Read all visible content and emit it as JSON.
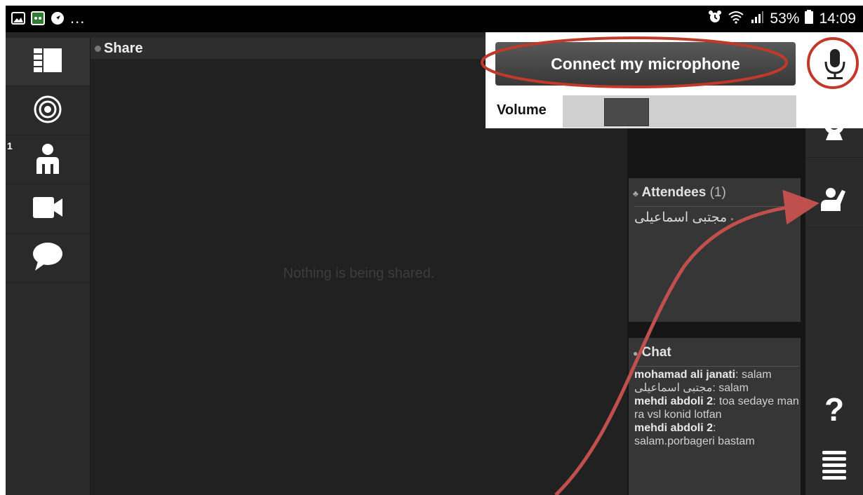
{
  "status_bar": {
    "notifications": [
      "image-icon",
      "gamepad-icon",
      "navigation-icon"
    ],
    "more": "...",
    "battery": "53%",
    "time": "14:09"
  },
  "left_nav": {
    "items": [
      {
        "name": "layout-icon"
      },
      {
        "name": "target-icon"
      },
      {
        "name": "participants-icon",
        "badge": "1"
      },
      {
        "name": "video-camera-icon"
      },
      {
        "name": "chat-bubble-icon"
      }
    ]
  },
  "share": {
    "title": "Share",
    "empty_message": "Nothing is being shared."
  },
  "attendees": {
    "title": "Attendees",
    "count": "(1)",
    "list": [
      "مجتبی اسماعیلی"
    ]
  },
  "chat": {
    "title": "Chat",
    "messages": [
      {
        "user": "mohamad ali janati",
        "text": ": salam"
      },
      {
        "user": "مجتبی اسماعیلی",
        "text": ": salam"
      },
      {
        "user": "mehdi abdoli 2",
        "text": ": toa sedaye man ra vsl konid lotfan"
      },
      {
        "user": "mehdi abdoli 2",
        "text": ": salam.porbageri bastam"
      }
    ]
  },
  "audio_popup": {
    "connect_label": "Connect my microphone",
    "volume_label": "Volume",
    "volume_level": 0.22
  },
  "right_bar": {
    "items": [
      "microphone-icon",
      "webcam-icon",
      "raise-hand-icon",
      "help-icon",
      "menu-icon"
    ],
    "help_label": "?"
  },
  "colors": {
    "annotation": "#c0392b",
    "annotation_arrow": "#c0504d"
  }
}
